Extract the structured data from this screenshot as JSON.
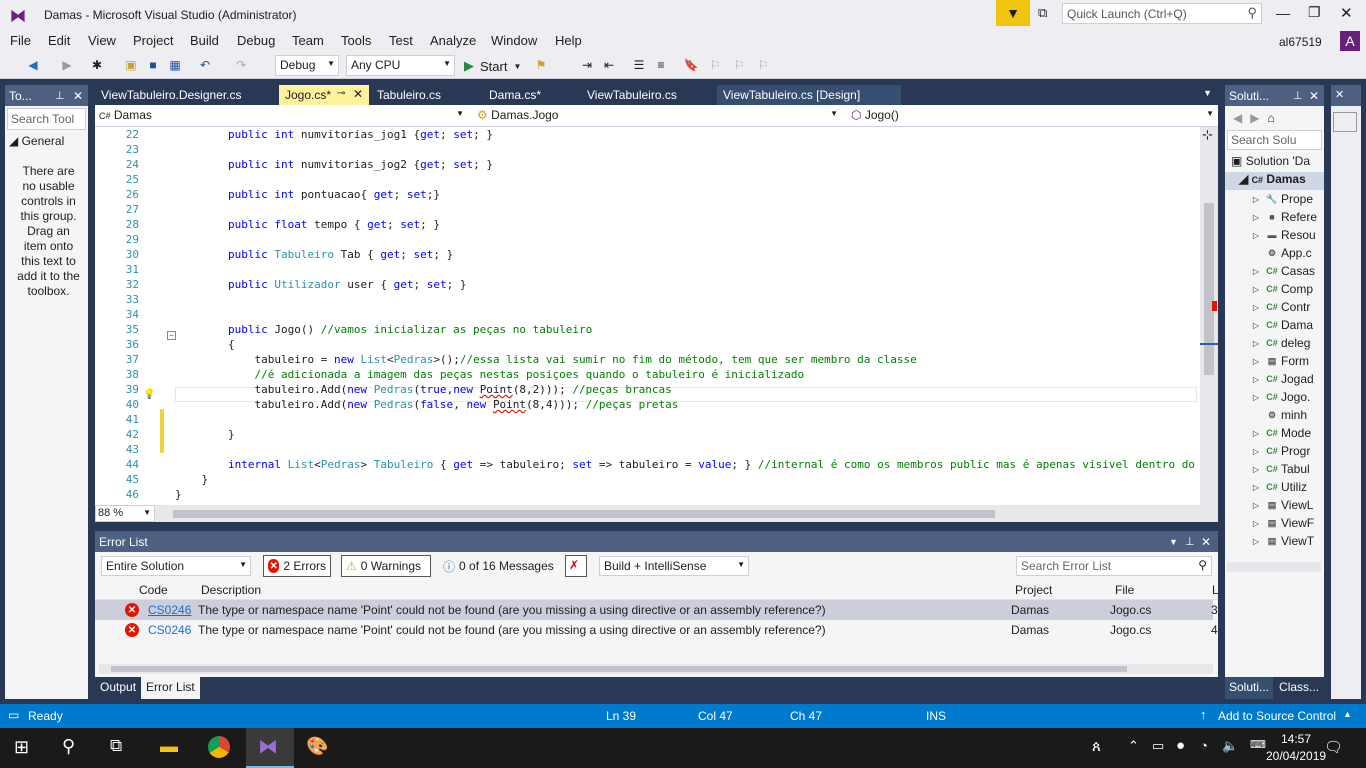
{
  "window": {
    "title": "Damas - Microsoft Visual Studio  (Administrator)",
    "quick_launch_placeholder": "Quick Launch (Ctrl+Q)",
    "user": "al67519",
    "avatar_letter": "A"
  },
  "menu": [
    "File",
    "Edit",
    "View",
    "Project",
    "Build",
    "Debug",
    "Team",
    "Tools",
    "Test",
    "Analyze",
    "Window",
    "Help"
  ],
  "toolbar": {
    "config": "Debug",
    "platform": "Any CPU",
    "start_label": "Start"
  },
  "toolbox": {
    "title": "To...",
    "search_placeholder": "Search Tool",
    "group": "General",
    "empty_text": "There are no usable controls in this group. Drag an item onto this text to add it to the toolbox."
  },
  "editor": {
    "tabs": [
      {
        "label": "ViewTabuleiro.Designer.cs",
        "active": false
      },
      {
        "label": "Jogo.cs*",
        "active": true
      },
      {
        "label": "Tabuleiro.cs",
        "active": false
      },
      {
        "label": "Dama.cs*",
        "active": false
      },
      {
        "label": "ViewTabuleiro.cs",
        "active": false
      },
      {
        "label": "ViewTabuleiro.cs [Design]",
        "active": false
      }
    ],
    "nav_project": "Damas",
    "nav_class": "Damas.Jogo",
    "nav_member": "Jogo()",
    "zoom": "88 %",
    "line_numbers": [
      "22",
      "23",
      "24",
      "25",
      "26",
      "27",
      "28",
      "29",
      "30",
      "31",
      "32",
      "33",
      "34",
      "35",
      "36",
      "37",
      "38",
      "39",
      "40",
      "41",
      "42",
      "43",
      "44",
      "45",
      "46"
    ],
    "lines": [
      "        public int numvitorias_jog1 {get; set; }",
      "",
      "        public int numvitorias_jog2 {get; set; }",
      "",
      "        public int pontuacao{ get; set;}",
      "",
      "        public float tempo { get; set; }",
      "",
      "        public Tabuleiro Tab { get; set; }",
      "",
      "        public Utilizador user { get; set; }",
      "",
      "",
      "        public Jogo() //vamos inicializar as peças no tabuleiro",
      "        {",
      "            tabuleiro = new List<Pedras>();//essa lista vai sumir no fim do método, tem que ser membro da classe",
      "            //é adicionada a imagem das peças nestas posiçoes quando o tabuleiro é inicializado",
      "            tabuleiro.Add(new Pedras(true,new Point(8,2))); //peças brancas",
      "            tabuleiro.Add(new Pedras(false, new Point(8,4))); //peças pretas",
      "",
      "        }",
      "",
      "        internal List<Pedras> Tabuleiro { get => tabuleiro; set => tabuleiro = value; } //internal é como os membros public mas é apenas visivel dentro do modulo c",
      "    }",
      "}"
    ]
  },
  "solution": {
    "title": "Soluti...",
    "search_placeholder": "Search Solu",
    "root": "Solution 'Da",
    "project": "Damas",
    "items": [
      "Prope",
      "Refere",
      "Resou",
      "App.c",
      "Casas",
      "Comp",
      "Contr",
      "Dama",
      "deleg",
      "Form",
      "Jogad",
      "Jogo.",
      "minh",
      "Mode",
      "Progr",
      "Tabul",
      "Utiliz",
      "ViewL",
      "ViewF",
      "ViewT"
    ],
    "bottom_tabs": [
      "Soluti...",
      "Class..."
    ]
  },
  "error_list": {
    "title": "Error List",
    "scope": "Entire Solution",
    "errors_label": "2 Errors",
    "warnings_label": "0 Warnings",
    "messages_label": "0 of 16 Messages",
    "build_filter": "Build + IntelliSense",
    "search_placeholder": "Search Error List",
    "columns": [
      "Code",
      "Description",
      "Project",
      "File",
      "L"
    ],
    "rows": [
      {
        "code": "CS0246",
        "description": "The type or namespace name 'Point' could not be found (are you missing a using directive or an assembly reference?)",
        "project": "Damas",
        "file": "Jogo.cs",
        "line": "3"
      },
      {
        "code": "CS0246",
        "description": "The type or namespace name 'Point' could not be found (are you missing a using directive or an assembly reference?)",
        "project": "Damas",
        "file": "Jogo.cs",
        "line": "4"
      }
    ],
    "bottom_tabs": [
      "Output",
      "Error List"
    ]
  },
  "status": {
    "ready": "Ready",
    "ln": "Ln 39",
    "col": "Col 47",
    "ch": "Ch 47",
    "ins": "INS",
    "source_control": "Add to Source Control"
  },
  "taskbar": {
    "time": "14:57",
    "date": "20/04/2019"
  }
}
